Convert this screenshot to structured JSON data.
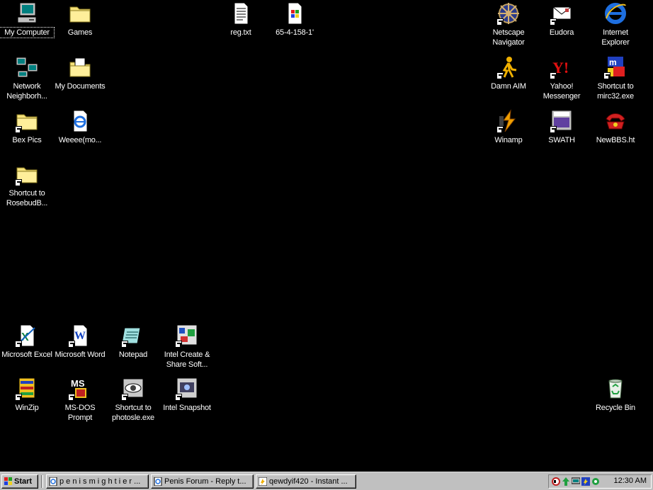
{
  "desktop": {
    "icons": [
      {
        "label": "My Computer",
        "icon": "my-computer-icon"
      },
      {
        "label": "Games",
        "icon": "folder-icon"
      },
      {
        "label": "reg.txt",
        "icon": "text-file-icon"
      },
      {
        "label": "65-4-158-1'",
        "icon": "windows-file-icon"
      },
      {
        "label": "Netscape Navigator",
        "icon": "netscape-icon"
      },
      {
        "label": "Eudora",
        "icon": "eudora-icon"
      },
      {
        "label": "Internet Explorer",
        "icon": "internet-explorer-icon"
      },
      {
        "label": "Network Neighborh...",
        "icon": "network-neighborhood-icon"
      },
      {
        "label": "My Documents",
        "icon": "my-documents-icon"
      },
      {
        "label": "Damn AIM",
        "icon": "aim-icon"
      },
      {
        "label": "Yahoo! Messenger",
        "icon": "yahoo-messenger-icon"
      },
      {
        "label": "Shortcut to mirc32.exe",
        "icon": "mirc-icon"
      },
      {
        "label": "Bex Pics",
        "icon": "folder-icon"
      },
      {
        "label": "Weeee(mo...",
        "icon": "ie-document-icon"
      },
      {
        "label": "Winamp",
        "icon": "winamp-icon"
      },
      {
        "label": "SWATH",
        "icon": "swath-icon"
      },
      {
        "label": "NewBBS.ht",
        "icon": "telephone-icon"
      },
      {
        "label": "Shortcut to RosebudB...",
        "icon": "folder-icon"
      },
      {
        "label": "Microsoft Excel",
        "icon": "excel-icon"
      },
      {
        "label": "Microsoft Word",
        "icon": "word-icon"
      },
      {
        "label": "Notepad",
        "icon": "notepad-icon"
      },
      {
        "label": "Intel Create & Share Soft...",
        "icon": "intel-create-share-icon"
      },
      {
        "label": "WinZip",
        "icon": "winzip-icon"
      },
      {
        "label": "MS-DOS Prompt",
        "icon": "ms-dos-icon"
      },
      {
        "label": "Shortcut to photosle.exe",
        "icon": "photo-eye-icon"
      },
      {
        "label": "Intel Snapshot",
        "icon": "intel-snapshot-icon"
      },
      {
        "label": "Recycle Bin",
        "icon": "recycle-bin-icon"
      }
    ]
  },
  "taskbar": {
    "start_label": "Start",
    "tasks": [
      {
        "label": "p e n i s  m i g h t i e r ...",
        "icon": "ie-page-icon"
      },
      {
        "label": "Penis Forum - Reply t...",
        "icon": "ie-page-icon"
      },
      {
        "label": "qewdyif420 - Instant ...",
        "icon": "aim-chat-icon"
      }
    ],
    "tray_icons": [
      "volume-icon",
      "network-icon",
      "monitor-icon",
      "aim-tray-icon",
      "system-icon"
    ],
    "clock": "12:30 AM"
  },
  "colors": {
    "desktop_background": "#000000",
    "taskbar": "#c0c0c0",
    "label_text": "#ffffff"
  }
}
